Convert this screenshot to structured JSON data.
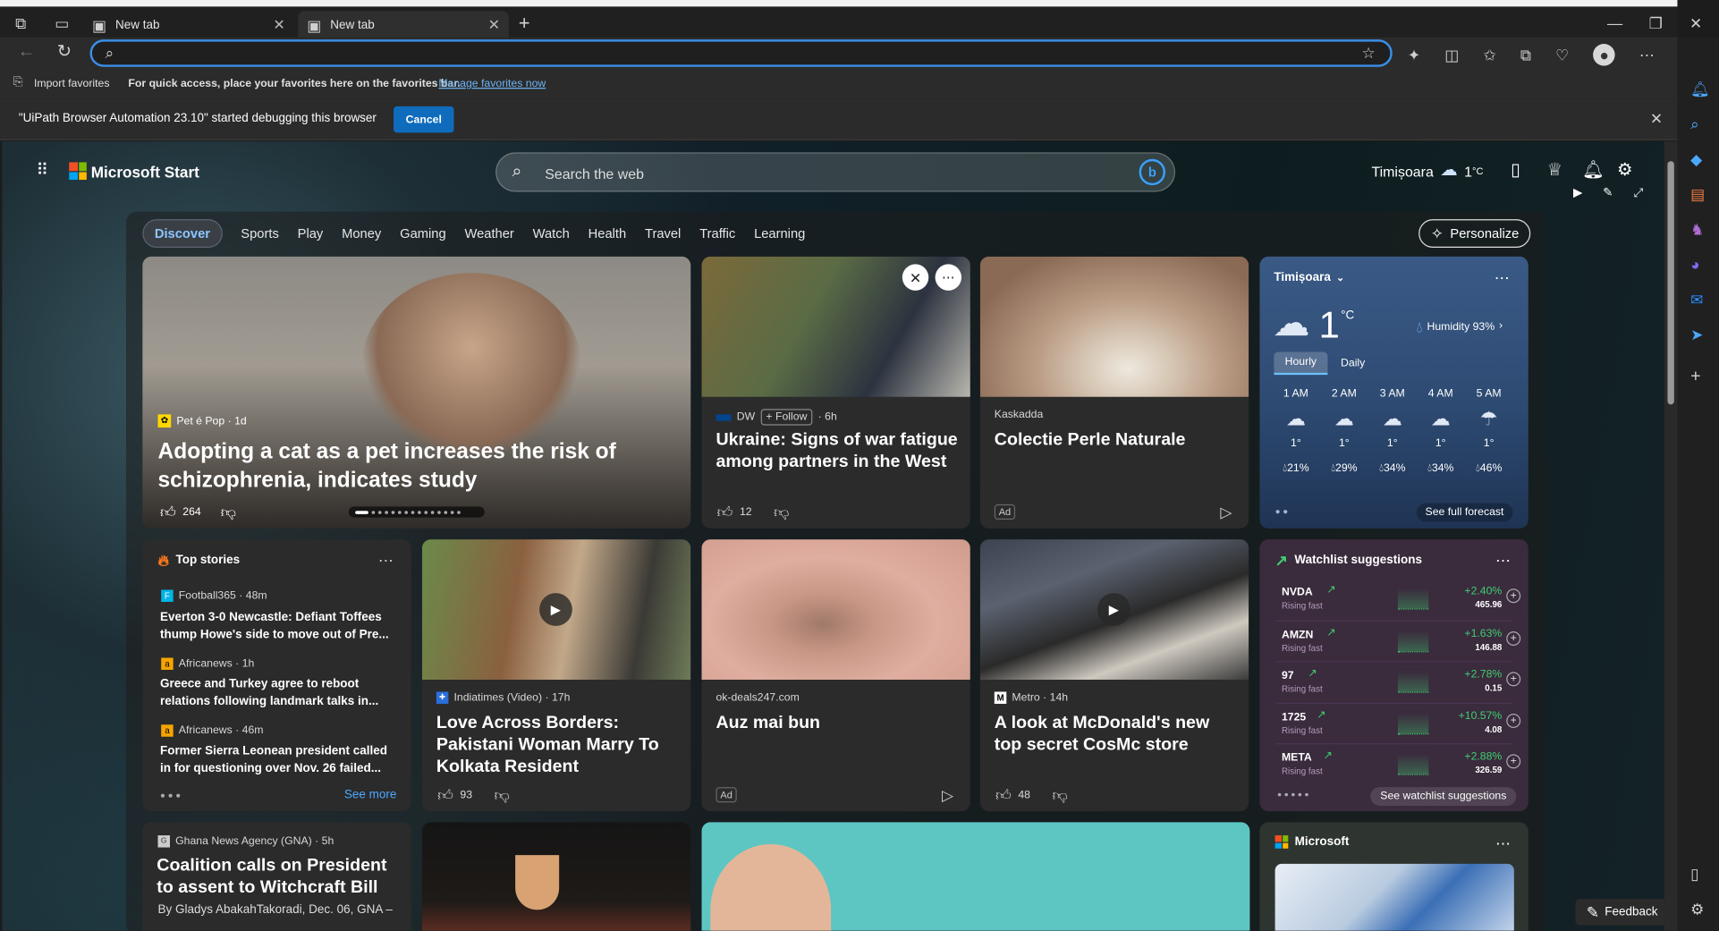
{
  "tabs": [
    {
      "label": "New tab"
    },
    {
      "label": "New tab"
    }
  ],
  "address": {
    "value": ""
  },
  "favorites_bar": {
    "import_label": "Import favorites",
    "message": "For quick access, place your favorites here on the favorites bar.",
    "link": "Manage favorites now"
  },
  "infobar": {
    "message": "\"UiPath Browser Automation 23.10\" started debugging this browser",
    "cancel": "Cancel"
  },
  "header": {
    "brand": "Microsoft Start",
    "search_placeholder": "Search the web",
    "location": "Timișoara",
    "temp": "1",
    "unit": "°C"
  },
  "nav": {
    "items": [
      "Discover",
      "Sports",
      "Play",
      "Money",
      "Gaming",
      "Weather",
      "Watch",
      "Health",
      "Travel",
      "Traffic",
      "Learning"
    ],
    "personalize": "Personalize"
  },
  "hero": {
    "source": "Pet é Pop · 1d",
    "title": "Adopting a cat as a pet increases the risk of schizophrenia, indicates study",
    "likes": "264"
  },
  "card_dw": {
    "source": "DW",
    "follow": "+ Follow",
    "age": "· 6h",
    "title": "Ukraine: Signs of war fatigue among partners in the West",
    "likes": "12"
  },
  "card_perle": {
    "source": "Kaskadda",
    "title": "Colectie Perle Naturale",
    "ad": "Ad"
  },
  "weather": {
    "location": "Timișoara",
    "temp": "1",
    "unit": "°C",
    "humidity": "Humidity 93%",
    "tabs": [
      "Hourly",
      "Daily"
    ],
    "hours": [
      {
        "t": "1 AM",
        "temp": "1°",
        "p": "21%"
      },
      {
        "t": "2 AM",
        "temp": "1°",
        "p": "29%"
      },
      {
        "t": "3 AM",
        "temp": "1°",
        "p": "34%"
      },
      {
        "t": "4 AM",
        "temp": "1°",
        "p": "34%"
      },
      {
        "t": "5 AM",
        "temp": "1°",
        "p": "46%"
      }
    ],
    "forecast_btn": "See full forecast"
  },
  "top_stories": {
    "title": "Top stories",
    "items": [
      {
        "source": "Football365 · 48m",
        "title": "Everton 3-0 Newcastle: Defiant Toffees thump Howe's side to move out of Pre..."
      },
      {
        "source": "Africanews · 1h",
        "title": "Greece and Turkey agree to reboot relations following landmark talks in..."
      },
      {
        "source": "Africanews · 46m",
        "title": "Former Sierra Leonean president called in for questioning over Nov. 26 failed..."
      }
    ],
    "see_more": "See more"
  },
  "card_india": {
    "source": "Indiatimes (Video) · 17h",
    "title": "Love Across Borders: Pakistani Woman Marry To Kolkata Resident",
    "likes": "93"
  },
  "card_ear": {
    "source": "ok-deals247.com",
    "title": "Auz mai bun",
    "ad": "Ad"
  },
  "card_mcd": {
    "source": "Metro · 14h",
    "title": "A look at McDonald's new top secret CosMc store",
    "likes": "48"
  },
  "watchlist": {
    "title": "Watchlist suggestions",
    "stocks": [
      {
        "sym": "NVDA",
        "sub": "Rising fast",
        "chg": "+2.40%",
        "price": "465.96"
      },
      {
        "sym": "AMZN",
        "sub": "Rising fast",
        "chg": "+1.63%",
        "price": "146.88"
      },
      {
        "sym": "97",
        "sub": "Rising fast",
        "chg": "+2.78%",
        "price": "0.15"
      },
      {
        "sym": "1725",
        "sub": "Rising fast",
        "chg": "+10.57%",
        "price": "4.08"
      },
      {
        "sym": "META",
        "sub": "Rising fast",
        "chg": "+2.88%",
        "price": "326.59"
      }
    ],
    "btn": "See watchlist suggestions"
  },
  "card_ghana": {
    "source": "Ghana News Agency (GNA) · 5h",
    "title": "Coalition calls on President to assent to Witchcraft Bill",
    "byline": "By Gladys AbakahTakoradi, Dec. 06, GNA –"
  },
  "card_microsoft": {
    "title": "Microsoft"
  },
  "feedback": "Feedback"
}
